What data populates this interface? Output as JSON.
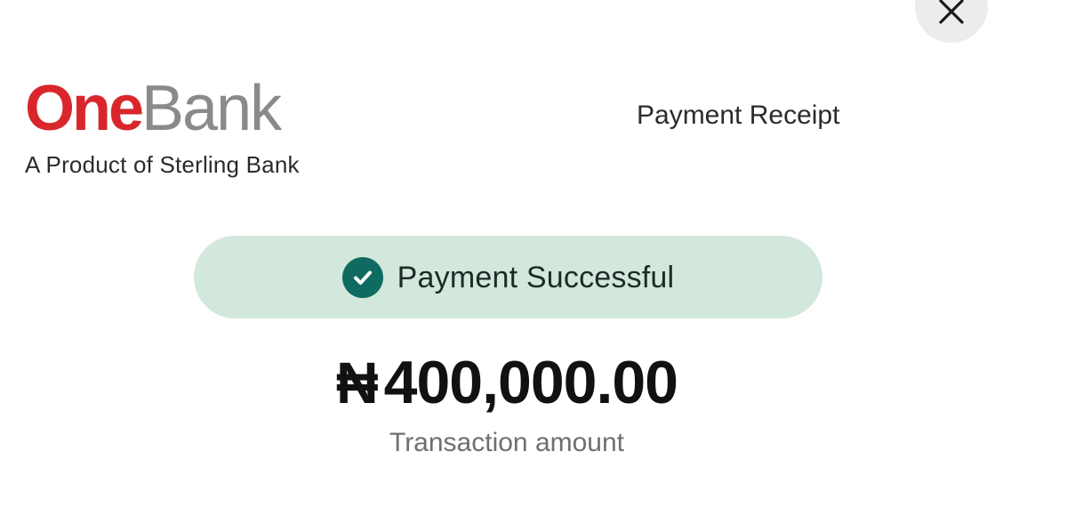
{
  "header": {
    "close_icon": "close-icon",
    "brand": {
      "logo_part1": "One",
      "logo_part2": "Bank",
      "logo_part1_color": "#d9262c",
      "logo_part2_color": "#8a8a8a",
      "tagline": "A Product of Sterling Bank"
    },
    "title": "Payment Receipt"
  },
  "status": {
    "icon": "check-circle-icon",
    "label": "Payment Successful",
    "pill_color": "#d3e8dc",
    "icon_color": "#0f6b62"
  },
  "transaction": {
    "currency_symbol": "₦",
    "amount": "400,000.00",
    "amount_label": "Transaction amount"
  }
}
